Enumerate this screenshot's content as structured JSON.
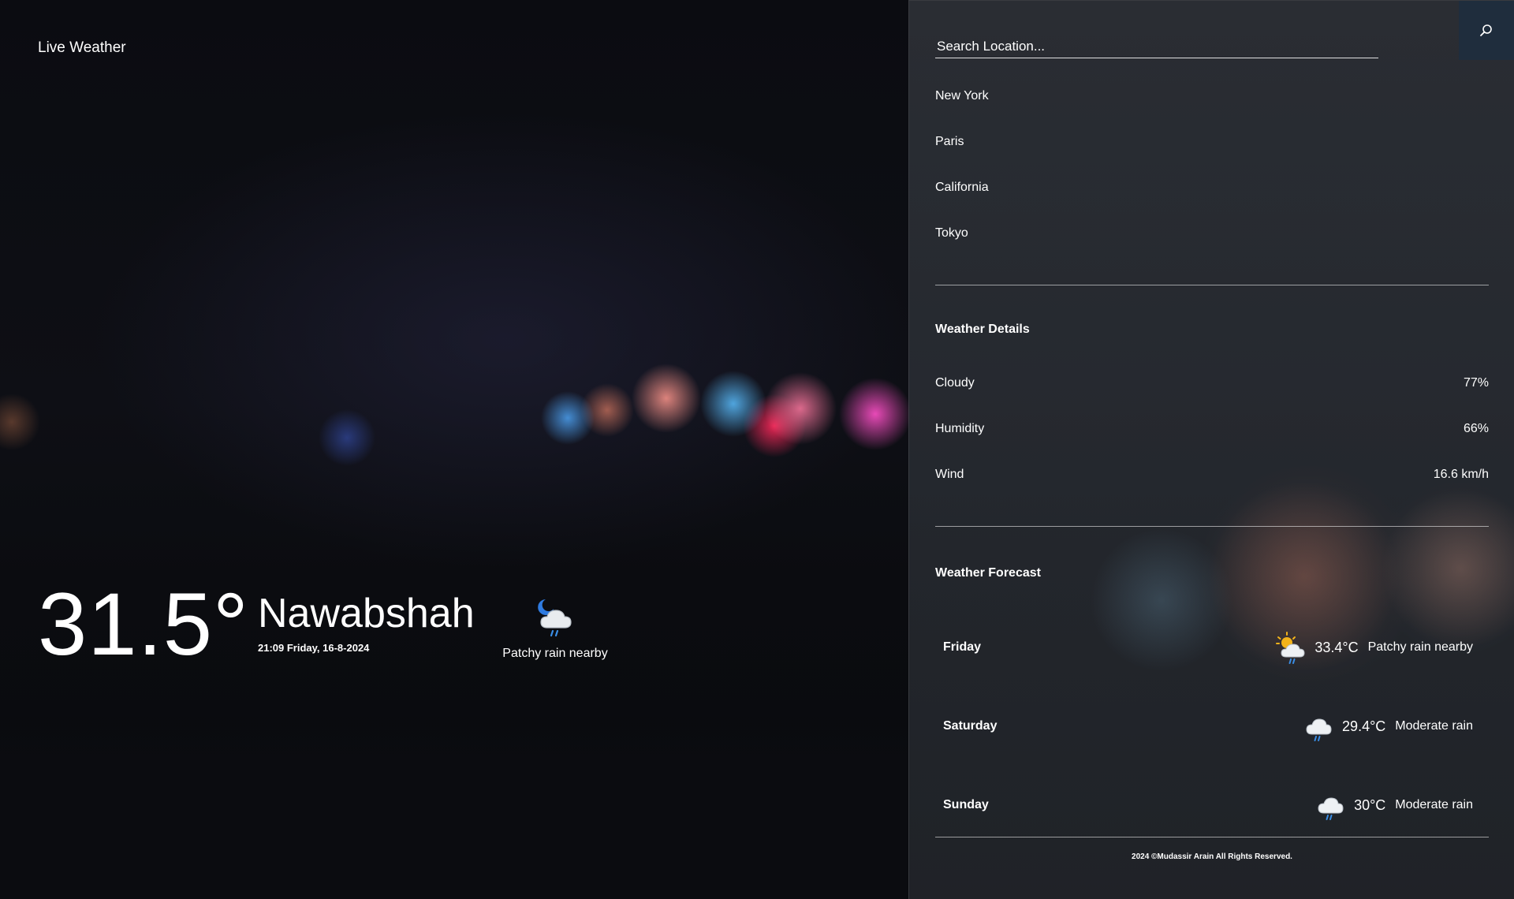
{
  "app": {
    "title": "Live Weather"
  },
  "current": {
    "temperature": "31.5°",
    "city": "Nawabshah",
    "datetime": "21:09 Friday, 16-8-2024",
    "condition": "Patchy rain nearby",
    "icon": "night-cloud-rain-icon"
  },
  "search": {
    "placeholder": "Search Location..."
  },
  "locations": [
    "New York",
    "Paris",
    "California",
    "Tokyo"
  ],
  "details": {
    "title": "Weather Details",
    "rows": [
      {
        "label": "Cloudy",
        "value": "77%"
      },
      {
        "label": "Humidity",
        "value": "66%"
      },
      {
        "label": "Wind",
        "value": "16.6 km/h"
      }
    ]
  },
  "forecast": {
    "title": "Weather Forecast",
    "days": [
      {
        "day": "Friday",
        "temp": "33.4°C",
        "condition": "Patchy rain nearby",
        "icon": "sun-cloud-rain-icon"
      },
      {
        "day": "Saturday",
        "temp": "29.4°C",
        "condition": "Moderate rain",
        "icon": "cloud-rain-icon"
      },
      {
        "day": "Sunday",
        "temp": "30°C",
        "condition": "Moderate rain",
        "icon": "cloud-rain-icon"
      }
    ]
  },
  "footer": {
    "text": "2024 ©Mudassir Arain All Rights Reserved."
  },
  "colors": {
    "search_button_bg": "#1f2d3d",
    "rain_accent": "#3a8ee6",
    "moon": "#2f7be0",
    "sun": "#f3b31a"
  }
}
